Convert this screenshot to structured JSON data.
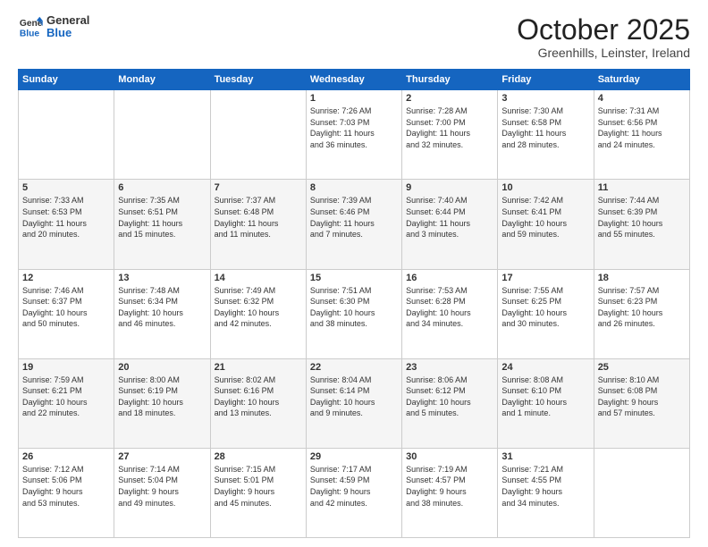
{
  "logo": {
    "line1": "General",
    "line2": "Blue"
  },
  "title": "October 2025",
  "location": "Greenhills, Leinster, Ireland",
  "days_of_week": [
    "Sunday",
    "Monday",
    "Tuesday",
    "Wednesday",
    "Thursday",
    "Friday",
    "Saturday"
  ],
  "weeks": [
    [
      {
        "day": "",
        "info": ""
      },
      {
        "day": "",
        "info": ""
      },
      {
        "day": "",
        "info": ""
      },
      {
        "day": "1",
        "info": "Sunrise: 7:26 AM\nSunset: 7:03 PM\nDaylight: 11 hours\nand 36 minutes."
      },
      {
        "day": "2",
        "info": "Sunrise: 7:28 AM\nSunset: 7:00 PM\nDaylight: 11 hours\nand 32 minutes."
      },
      {
        "day": "3",
        "info": "Sunrise: 7:30 AM\nSunset: 6:58 PM\nDaylight: 11 hours\nand 28 minutes."
      },
      {
        "day": "4",
        "info": "Sunrise: 7:31 AM\nSunset: 6:56 PM\nDaylight: 11 hours\nand 24 minutes."
      }
    ],
    [
      {
        "day": "5",
        "info": "Sunrise: 7:33 AM\nSunset: 6:53 PM\nDaylight: 11 hours\nand 20 minutes."
      },
      {
        "day": "6",
        "info": "Sunrise: 7:35 AM\nSunset: 6:51 PM\nDaylight: 11 hours\nand 15 minutes."
      },
      {
        "day": "7",
        "info": "Sunrise: 7:37 AM\nSunset: 6:48 PM\nDaylight: 11 hours\nand 11 minutes."
      },
      {
        "day": "8",
        "info": "Sunrise: 7:39 AM\nSunset: 6:46 PM\nDaylight: 11 hours\nand 7 minutes."
      },
      {
        "day": "9",
        "info": "Sunrise: 7:40 AM\nSunset: 6:44 PM\nDaylight: 11 hours\nand 3 minutes."
      },
      {
        "day": "10",
        "info": "Sunrise: 7:42 AM\nSunset: 6:41 PM\nDaylight: 10 hours\nand 59 minutes."
      },
      {
        "day": "11",
        "info": "Sunrise: 7:44 AM\nSunset: 6:39 PM\nDaylight: 10 hours\nand 55 minutes."
      }
    ],
    [
      {
        "day": "12",
        "info": "Sunrise: 7:46 AM\nSunset: 6:37 PM\nDaylight: 10 hours\nand 50 minutes."
      },
      {
        "day": "13",
        "info": "Sunrise: 7:48 AM\nSunset: 6:34 PM\nDaylight: 10 hours\nand 46 minutes."
      },
      {
        "day": "14",
        "info": "Sunrise: 7:49 AM\nSunset: 6:32 PM\nDaylight: 10 hours\nand 42 minutes."
      },
      {
        "day": "15",
        "info": "Sunrise: 7:51 AM\nSunset: 6:30 PM\nDaylight: 10 hours\nand 38 minutes."
      },
      {
        "day": "16",
        "info": "Sunrise: 7:53 AM\nSunset: 6:28 PM\nDaylight: 10 hours\nand 34 minutes."
      },
      {
        "day": "17",
        "info": "Sunrise: 7:55 AM\nSunset: 6:25 PM\nDaylight: 10 hours\nand 30 minutes."
      },
      {
        "day": "18",
        "info": "Sunrise: 7:57 AM\nSunset: 6:23 PM\nDaylight: 10 hours\nand 26 minutes."
      }
    ],
    [
      {
        "day": "19",
        "info": "Sunrise: 7:59 AM\nSunset: 6:21 PM\nDaylight: 10 hours\nand 22 minutes."
      },
      {
        "day": "20",
        "info": "Sunrise: 8:00 AM\nSunset: 6:19 PM\nDaylight: 10 hours\nand 18 minutes."
      },
      {
        "day": "21",
        "info": "Sunrise: 8:02 AM\nSunset: 6:16 PM\nDaylight: 10 hours\nand 13 minutes."
      },
      {
        "day": "22",
        "info": "Sunrise: 8:04 AM\nSunset: 6:14 PM\nDaylight: 10 hours\nand 9 minutes."
      },
      {
        "day": "23",
        "info": "Sunrise: 8:06 AM\nSunset: 6:12 PM\nDaylight: 10 hours\nand 5 minutes."
      },
      {
        "day": "24",
        "info": "Sunrise: 8:08 AM\nSunset: 6:10 PM\nDaylight: 10 hours\nand 1 minute."
      },
      {
        "day": "25",
        "info": "Sunrise: 8:10 AM\nSunset: 6:08 PM\nDaylight: 9 hours\nand 57 minutes."
      }
    ],
    [
      {
        "day": "26",
        "info": "Sunrise: 7:12 AM\nSunset: 5:06 PM\nDaylight: 9 hours\nand 53 minutes."
      },
      {
        "day": "27",
        "info": "Sunrise: 7:14 AM\nSunset: 5:04 PM\nDaylight: 9 hours\nand 49 minutes."
      },
      {
        "day": "28",
        "info": "Sunrise: 7:15 AM\nSunset: 5:01 PM\nDaylight: 9 hours\nand 45 minutes."
      },
      {
        "day": "29",
        "info": "Sunrise: 7:17 AM\nSunset: 4:59 PM\nDaylight: 9 hours\nand 42 minutes."
      },
      {
        "day": "30",
        "info": "Sunrise: 7:19 AM\nSunset: 4:57 PM\nDaylight: 9 hours\nand 38 minutes."
      },
      {
        "day": "31",
        "info": "Sunrise: 7:21 AM\nSunset: 4:55 PM\nDaylight: 9 hours\nand 34 minutes."
      },
      {
        "day": "",
        "info": ""
      }
    ]
  ]
}
